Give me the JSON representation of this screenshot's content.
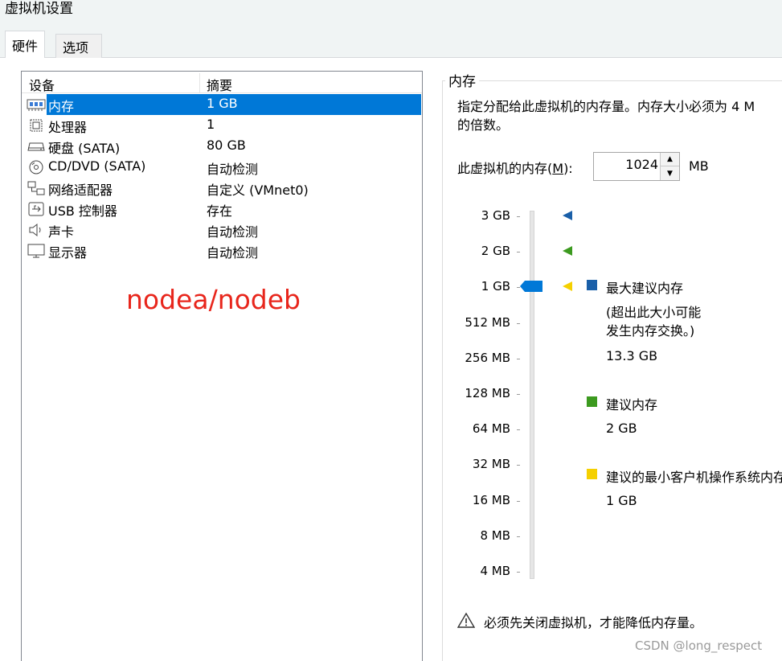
{
  "window": {
    "title": "虚拟机设置"
  },
  "tabs": [
    {
      "label": "硬件"
    },
    {
      "label": "选项"
    }
  ],
  "device_list": {
    "columns": [
      "设备",
      "摘要"
    ],
    "rows": [
      {
        "name": "内存",
        "summary": "1 GB",
        "icon": "memory-icon",
        "selected": true
      },
      {
        "name": "处理器",
        "summary": "1",
        "icon": "processor-icon"
      },
      {
        "name": "硬盘 (SATA)",
        "summary": "80 GB",
        "icon": "hard-disk-icon"
      },
      {
        "name": "CD/DVD (SATA)",
        "summary": "自动检测",
        "icon": "cd-dvd-icon"
      },
      {
        "name": "网络适配器",
        "summary": "自定义 (VMnet0)",
        "icon": "network-adapter-icon"
      },
      {
        "name": "USB 控制器",
        "summary": "存在",
        "icon": "usb-icon"
      },
      {
        "name": "声卡",
        "summary": "自动检测",
        "icon": "sound-card-icon"
      },
      {
        "name": "显示器",
        "summary": "自动检测",
        "icon": "monitor-icon"
      }
    ]
  },
  "annotation": "nodea/nodeb",
  "memory": {
    "group_title": "内存",
    "description": "指定分配给此虚拟机的内存量。内存大小必须为 4 M\n的倍数。",
    "label_prefix": "此虚拟机的内存(",
    "label_accel": "M",
    "label_suffix": "):",
    "value": "1024",
    "unit": "MB",
    "scale": [
      "3 GB",
      "2 GB",
      "1 GB",
      "512 MB",
      "256 MB",
      "128 MB",
      "64 MB",
      "32 MB",
      "16 MB",
      "8 MB",
      "4 MB"
    ],
    "current_mark": "1 GB",
    "legend": [
      {
        "label": "最大建议内存",
        "note": "(超出此大小可能\n发生内存交换。)",
        "value": "13.3 GB",
        "color": "#1a5fa8"
      },
      {
        "label": "建议内存",
        "value": "2 GB",
        "color": "#3c9a1f"
      },
      {
        "label": "建议的最小客户机操作系统内存",
        "value": "1 GB",
        "color": "#f5d000"
      }
    ],
    "marker_colors": {
      "max": "#1a5fa8",
      "recommended": "#3c9a1f",
      "minimum": "#f5d000",
      "slider": "#0078d7"
    },
    "warning": "必须先关闭虚拟机，才能降低内存量。"
  },
  "watermark": "CSDN @long_respect"
}
